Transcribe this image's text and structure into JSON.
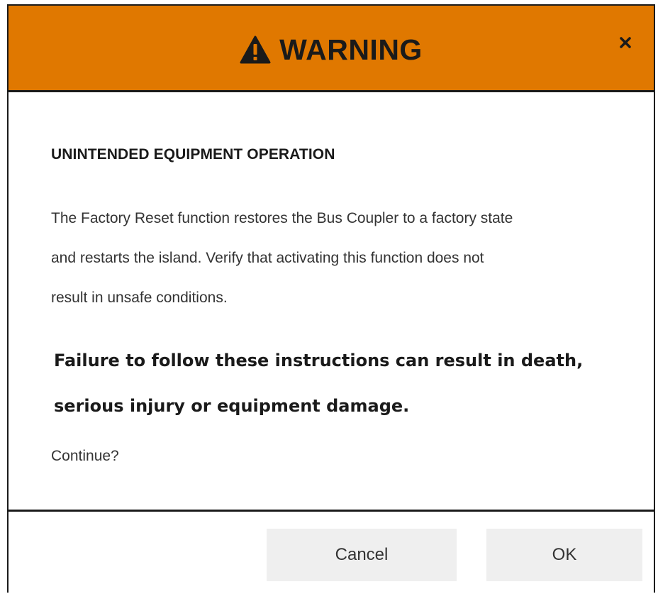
{
  "dialog": {
    "title": "WARNING",
    "title_icon": "warning-triangle-icon",
    "close_icon": "close-icon",
    "header_color": "#e07800",
    "heading": "UNINTENDED EQUIPMENT OPERATION",
    "message_lines": [
      "The Factory Reset function restores the Bus Coupler to a factory state",
      "and restarts the island. Verify that activating this function does not",
      "result in unsafe conditions."
    ],
    "consequence_lines": [
      "Failure to follow these instructions can result in death,",
      "serious injury or equipment damage."
    ],
    "prompt": "Continue?",
    "buttons": {
      "cancel": "Cancel",
      "ok": "OK"
    }
  }
}
